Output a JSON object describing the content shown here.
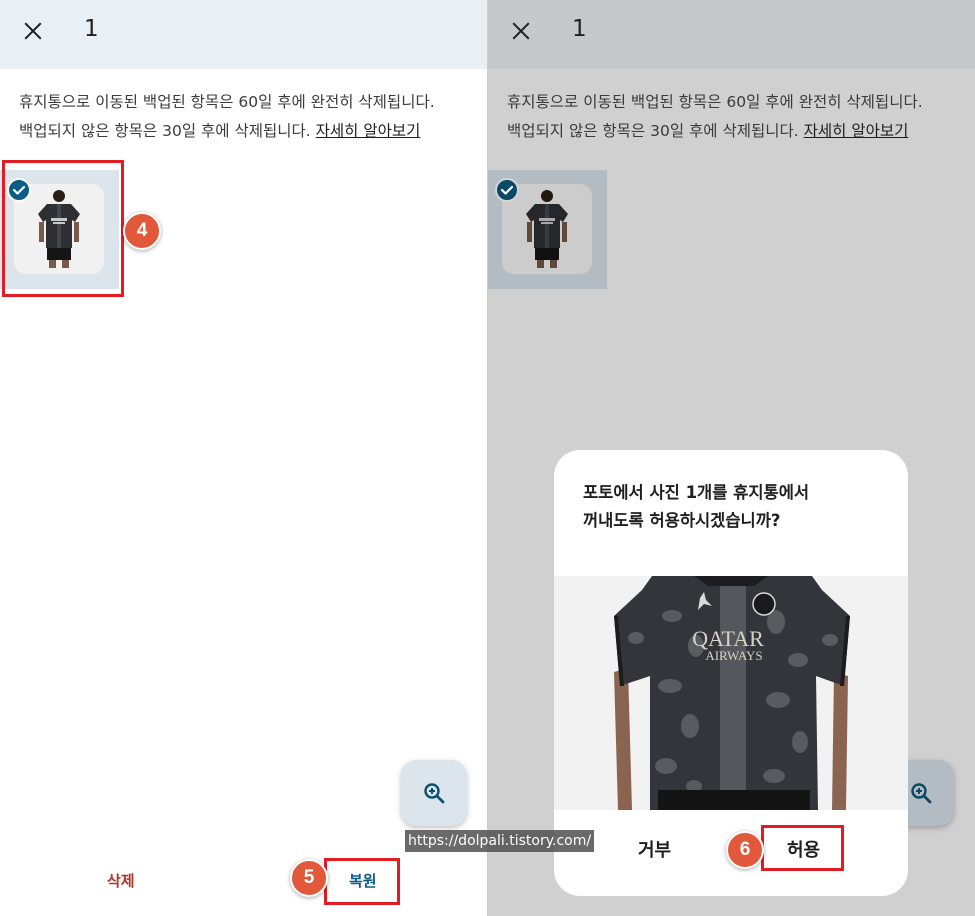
{
  "left_panel": {
    "selected_count": "1",
    "info_line1": "휴지통으로 이동된 백업된 항목은 60일 후에 완전히 삭제됩니다.",
    "info_line2": "백업되지 않은 항목은 30일 후에 삭제됩니다.",
    "learn_more": "자세히 알아보기",
    "delete_label": "삭제",
    "restore_label": "복원",
    "step_thumbnail": "4",
    "step_restore": "5"
  },
  "right_panel": {
    "selected_count": "1",
    "info_line1": "휴지통으로 이동된 백업된 항목은 60일 후에 완전히 삭제됩니다.",
    "info_line2": "백업되지 않은 항목은 30일 후에 삭제됩니다.",
    "learn_more": "자세히 알아보기"
  },
  "dialog": {
    "title_line1": "포토에서 사진 1개를 휴지통에서",
    "title_line2": "꺼내도록 허용하시겠습니까?",
    "deny_label": "거부",
    "allow_label": "허용",
    "step_allow": "6"
  },
  "jersey": {
    "sponsor_line1": "QATAR",
    "sponsor_line2": "AIRWAYS"
  },
  "watermark": "https://dolpali.tistory.com/",
  "icons": {
    "close": "close-icon",
    "check": "check-circle-icon",
    "zoom": "zoom-in-icon"
  },
  "colors": {
    "accent_blue": "#0b5d86",
    "delete_red": "#b2352b",
    "highlight_red": "#e31b23",
    "badge_orange": "#e1583b"
  }
}
